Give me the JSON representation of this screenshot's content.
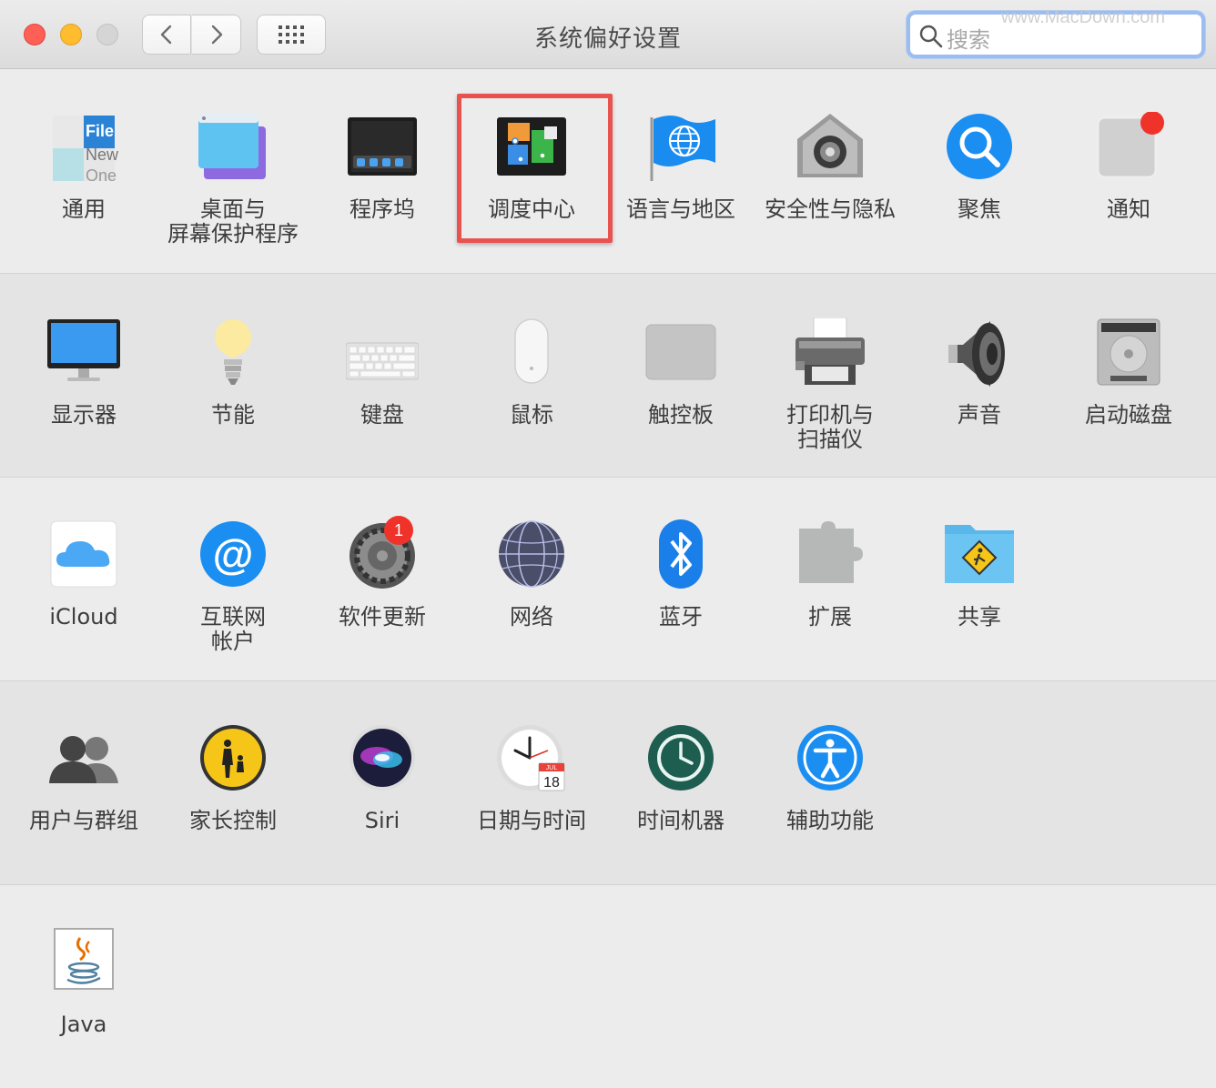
{
  "window": {
    "title": "系统偏好设置",
    "search_placeholder": "搜索",
    "watermark": "www.MacDown.com"
  },
  "rows": [
    {
      "items": [
        {
          "label": "通用",
          "icon": "general-icon"
        },
        {
          "label": "桌面与\n屏幕保护程序",
          "icon": "desktop-screensaver-icon"
        },
        {
          "label": "程序坞",
          "icon": "dock-icon"
        },
        {
          "label": "调度中心",
          "icon": "mission-control-icon"
        },
        {
          "label": "语言与地区",
          "icon": "language-region-icon"
        },
        {
          "label": "安全性与隐私",
          "icon": "security-privacy-icon"
        },
        {
          "label": "聚焦",
          "icon": "spotlight-icon"
        },
        {
          "label": "通知",
          "icon": "notifications-icon"
        }
      ]
    },
    {
      "items": [
        {
          "label": "显示器",
          "icon": "displays-icon"
        },
        {
          "label": "节能",
          "icon": "energy-saver-icon"
        },
        {
          "label": "键盘",
          "icon": "keyboard-icon"
        },
        {
          "label": "鼠标",
          "icon": "mouse-icon"
        },
        {
          "label": "触控板",
          "icon": "trackpad-icon"
        },
        {
          "label": "打印机与\n扫描仪",
          "icon": "printers-scanners-icon"
        },
        {
          "label": "声音",
          "icon": "sound-icon"
        },
        {
          "label": "启动磁盘",
          "icon": "startup-disk-icon"
        }
      ]
    },
    {
      "items": [
        {
          "label": "iCloud",
          "icon": "icloud-icon"
        },
        {
          "label": "互联网\n帐户",
          "icon": "internet-accounts-icon"
        },
        {
          "label": "软件更新",
          "icon": "software-update-icon",
          "badge": "1"
        },
        {
          "label": "网络",
          "icon": "network-icon"
        },
        {
          "label": "蓝牙",
          "icon": "bluetooth-icon"
        },
        {
          "label": "扩展",
          "icon": "extensions-icon"
        },
        {
          "label": "共享",
          "icon": "sharing-icon"
        }
      ]
    },
    {
      "items": [
        {
          "label": "用户与群组",
          "icon": "users-groups-icon"
        },
        {
          "label": "家长控制",
          "icon": "parental-controls-icon"
        },
        {
          "label": "Siri",
          "icon": "siri-icon"
        },
        {
          "label": "日期与时间",
          "icon": "date-time-icon",
          "calendar_month": "JUL",
          "calendar_day": "18"
        },
        {
          "label": "时间机器",
          "icon": "time-machine-icon"
        },
        {
          "label": "辅助功能",
          "icon": "accessibility-icon"
        }
      ]
    },
    {
      "items": [
        {
          "label": "Java",
          "icon": "java-icon"
        }
      ]
    }
  ],
  "general_icon_text": {
    "line1": "File",
    "line2": "New",
    "line3": "One"
  },
  "highlighted_item": "调度中心",
  "colors": {
    "highlight": "#e9534f",
    "badge": "#f0332a",
    "accent": "#1a8cf0"
  }
}
